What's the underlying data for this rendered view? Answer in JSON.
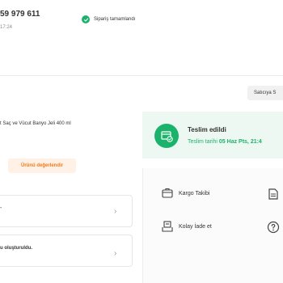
{
  "order": {
    "number": "59 979 611",
    "time": "17:24",
    "status": "Sipariş tamamlandı"
  },
  "seller_button": "Satıcıya S",
  "product": {
    "name": "t Saç ve Vücut Banyo Jeli 400 ml",
    "rate_label": "Ürünü değerlendir"
  },
  "delivery": {
    "title": "Teslim edildi",
    "date_prefix": "Teslim tarihi",
    "date_value": "05 Haz Pts, 21:4"
  },
  "actions": [
    {
      "label": "Kargo Takibi",
      "icon": "package-icon",
      "side_icon": "document-icon"
    },
    {
      "label": "Kolay İade et",
      "icon": "return-box-icon",
      "side_icon": "help-icon"
    }
  ],
  "cards": [
    {
      "text": "-"
    },
    {
      "text": "u oluşturuldu."
    }
  ],
  "colors": {
    "accent": "#f27a1a",
    "success": "#1bb36b"
  }
}
